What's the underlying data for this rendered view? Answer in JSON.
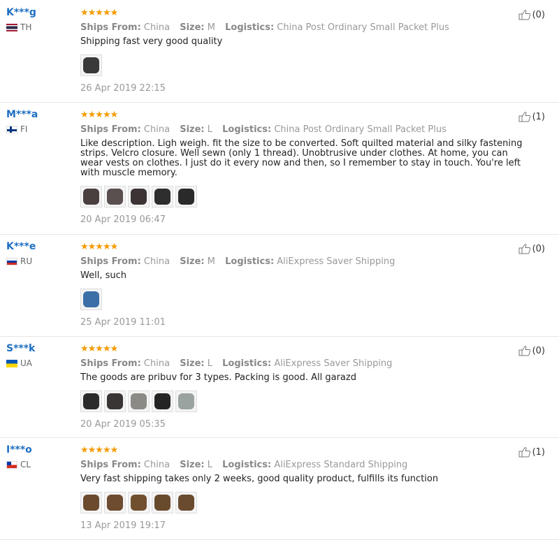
{
  "reviews": [
    {
      "username": "K***g",
      "country": "TH",
      "flag": "th",
      "stars": "★★★★★",
      "ships_from_label": "Ships From:",
      "ships_from": "China",
      "size_label": "Size:",
      "size": "M",
      "logistics_label": "Logistics:",
      "logistics": "China Post Ordinary Small Packet Plus",
      "text": "Shipping fast very good quality",
      "date": "26 Apr 2019 22:15",
      "helpful": "(0)",
      "thumbs": [
        "#3a3a3a"
      ]
    },
    {
      "username": "M***a",
      "country": "FI",
      "flag": "fi",
      "stars": "★★★★★",
      "ships_from_label": "Ships From:",
      "ships_from": "China",
      "size_label": "Size:",
      "size": "L",
      "logistics_label": "Logistics:",
      "logistics": "China Post Ordinary Small Packet Plus",
      "text": "Like description. Ligh weigh. fit the size to be converted. Soft quilted material and silky fastening strips. Velcro closure. Well sewn (only 1 thread). Unobtrusive under clothes. At home, you can wear vests on clothes. I just do it every now and then, so I remember to stay in touch. You're left with muscle memory.",
      "date": "20 Apr 2019 06:47",
      "helpful": "(1)",
      "thumbs": [
        "#4a4040",
        "#5a5050",
        "#3c3434",
        "#2e2e2e",
        "#2a2a2a"
      ]
    },
    {
      "username": "K***e",
      "country": "RU",
      "flag": "ru",
      "stars": "★★★★★",
      "ships_from_label": "Ships From:",
      "ships_from": "China",
      "size_label": "Size:",
      "size": "M",
      "logistics_label": "Logistics:",
      "logistics": "AliExpress Saver Shipping",
      "text": "Well, such",
      "date": "25 Apr 2019 11:01",
      "helpful": "(0)",
      "thumbs": [
        "#3c6fa8"
      ]
    },
    {
      "username": "S***k",
      "country": "UA",
      "flag": "ua",
      "stars": "★★★★★",
      "ships_from_label": "Ships From:",
      "ships_from": "China",
      "size_label": "Size:",
      "size": "L",
      "logistics_label": "Logistics:",
      "logistics": "AliExpress Saver Shipping",
      "text": "The goods are pribuv for 3 types. Packing is good. All garazd",
      "date": "20 Apr 2019 05:35",
      "helpful": "(0)",
      "thumbs": [
        "#2b2b2b",
        "#3a3535",
        "#8c8a86",
        "#242424",
        "#9aa3a0"
      ]
    },
    {
      "username": "I***o",
      "country": "CL",
      "flag": "cl",
      "stars": "★★★★★",
      "ships_from_label": "Ships From:",
      "ships_from": "China",
      "size_label": "Size:",
      "size": "L",
      "logistics_label": "Logistics:",
      "logistics": "AliExpress Standard Shipping",
      "text": "Very fast shipping takes only 2 weeks, good quality product, fulfills its function",
      "date": "13 Apr 2019 19:17",
      "helpful": "(1)",
      "thumbs": [
        "#6b4a2e",
        "#6e4c30",
        "#71502f",
        "#684a2d",
        "#6a4b2f"
      ]
    }
  ]
}
